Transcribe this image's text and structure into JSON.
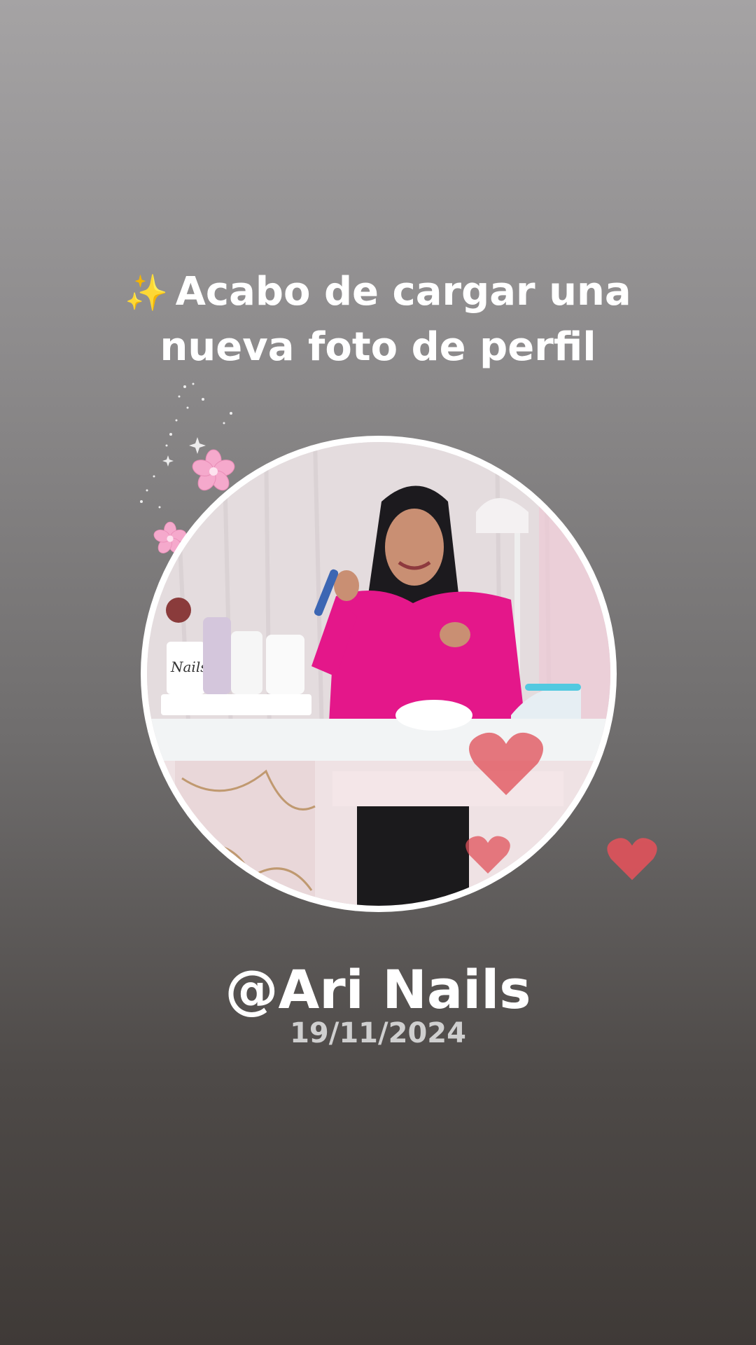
{
  "story": {
    "emoji": "✨",
    "headline_line1": "Acabo de cargar una",
    "headline_line2": "nueva foto de perfil",
    "handle": "@Ari Nails",
    "date": "19/11/2024"
  },
  "decorations": {
    "icons": [
      "sparkles-icon",
      "cherry-blossom-icon",
      "heart-icon"
    ],
    "colors": {
      "blossom": "#f5a9cc",
      "heart": "#e0525b",
      "ring": "#ffffff"
    }
  },
  "profile_photo": {
    "subject": "profile-photo",
    "mug_text": "Nails"
  }
}
